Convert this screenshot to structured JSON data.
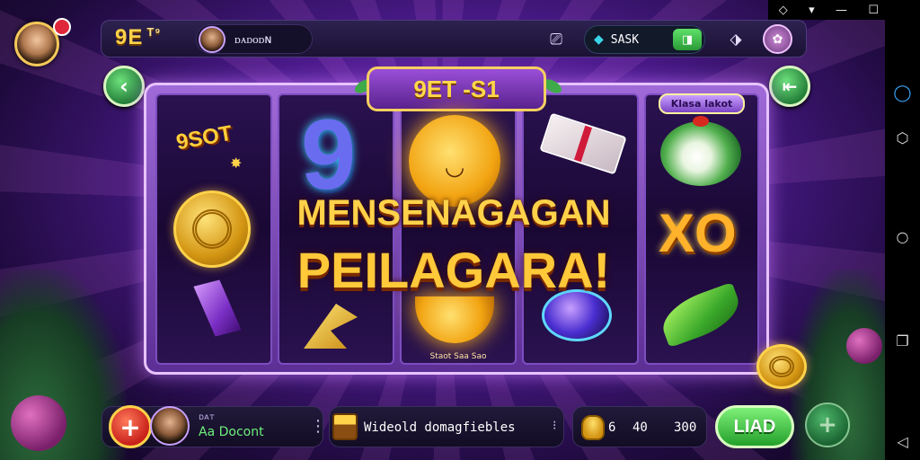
{
  "top": {
    "brand": "9E",
    "brand_sup": "T⁹",
    "notification_count": "",
    "player_name": "ᴅᴀᴅᴏᴅɴ",
    "balance_label": "SASK",
    "wallet_label": "◨"
  },
  "slot": {
    "title": "9ET -S1",
    "reel5_label": "Klasa lakot",
    "logo_symbol": "9SOT",
    "xo_symbol": "XO",
    "reel3_caption": "Staot Saa Sao",
    "headline_line1": "MENSENAGAGAN",
    "headline_line2": "PEILAGARA!"
  },
  "bottom": {
    "player_label": "ᴅᴀᴛ",
    "player_name": "Aa Docont",
    "promo_text": "Wideold domagfiebles",
    "bet_small": "6",
    "bet_value": "40",
    "bet_total": "300",
    "spin_label": "LIAD"
  },
  "colors": {
    "accent_gold": "#ffd24a",
    "spin_green": "#23a02a",
    "frame_purple": "#5c2f95"
  },
  "icons": [
    "back-arrow-icon",
    "menu-collapse-icon",
    "chat-icon",
    "share-icon",
    "gem-icon",
    "wallet-icon",
    "plus-icon",
    "chest-icon",
    "coins-icon"
  ]
}
